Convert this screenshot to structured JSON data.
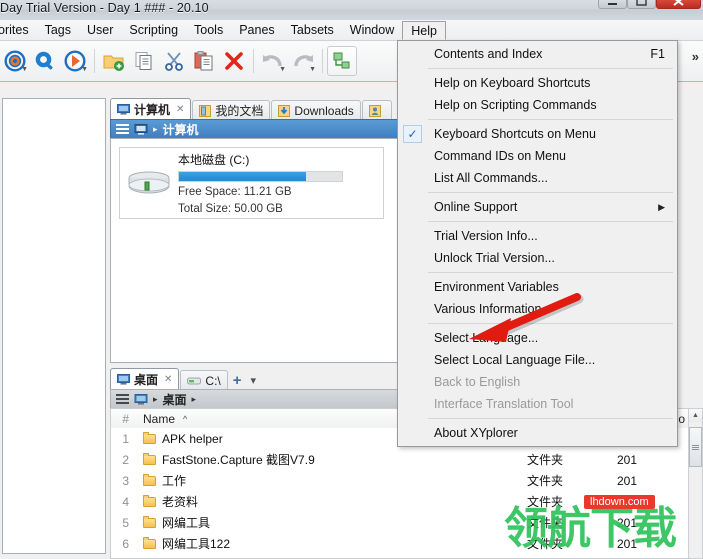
{
  "window": {
    "title": "Day Trial Version - Day 1 ### - 20.10",
    "controls": [
      {
        "name": "minimize",
        "glyph": "—"
      },
      {
        "name": "maximize",
        "glyph": "❐"
      },
      {
        "name": "close",
        "glyph": "✕"
      }
    ]
  },
  "menubar": {
    "items": [
      {
        "label": "orites",
        "open": false
      },
      {
        "label": "Tags",
        "open": false
      },
      {
        "label": "User",
        "open": false
      },
      {
        "label": "Scripting",
        "open": false
      },
      {
        "label": "Tools",
        "open": false
      },
      {
        "label": "Panes",
        "open": false
      },
      {
        "label": "Tabsets",
        "open": false
      },
      {
        "label": "Window",
        "open": false
      },
      {
        "label": "Help",
        "open": true
      }
    ]
  },
  "toolbar": {
    "overflow_label": "»",
    "buttons": [
      {
        "name": "target-icon",
        "has_caret": true
      },
      {
        "name": "search-icon",
        "has_caret": false
      },
      {
        "name": "go-icon",
        "has_caret": true
      },
      {
        "name": "new-folder-icon",
        "has_caret": false
      },
      {
        "name": "copy-icon",
        "has_caret": false
      },
      {
        "name": "cut-icon",
        "has_caret": false
      },
      {
        "name": "paste-icon",
        "has_caret": false
      },
      {
        "name": "delete-icon",
        "has_caret": false
      },
      {
        "name": "undo-icon",
        "has_caret": true
      },
      {
        "name": "redo-icon",
        "has_caret": true
      },
      {
        "name": "tree-icon",
        "has_caret": false
      }
    ]
  },
  "help_menu": {
    "items": [
      {
        "label": "Contents and Index",
        "accel": "F1",
        "type": "item"
      },
      {
        "type": "separator"
      },
      {
        "label": "Help on Keyboard Shortcuts",
        "type": "item"
      },
      {
        "label": "Help on Scripting Commands",
        "type": "item"
      },
      {
        "type": "separator"
      },
      {
        "label": "Keyboard Shortcuts on Menu",
        "type": "item",
        "checked": true
      },
      {
        "label": "Command IDs on Menu",
        "type": "item"
      },
      {
        "label": "List All Commands...",
        "type": "item"
      },
      {
        "type": "separator"
      },
      {
        "label": "Online Support",
        "type": "submenu",
        "submenu_glyph": "▶"
      },
      {
        "type": "separator"
      },
      {
        "label": "Trial Version Info...",
        "type": "item"
      },
      {
        "label": "Unlock Trial Version...",
        "type": "item"
      },
      {
        "type": "separator"
      },
      {
        "label": "Environment Variables",
        "type": "item"
      },
      {
        "label": "Various Information",
        "type": "item"
      },
      {
        "type": "separator"
      },
      {
        "label": "Select Language...",
        "type": "item"
      },
      {
        "label": "Select Local Language File...",
        "type": "item"
      },
      {
        "label": "Back to English",
        "type": "item",
        "disabled": true
      },
      {
        "label": "Interface Translation Tool",
        "type": "item",
        "disabled": true
      },
      {
        "type": "separator"
      },
      {
        "label": "About XYplorer",
        "type": "item"
      }
    ]
  },
  "top_pane": {
    "tabs": [
      {
        "label": "计算机",
        "active": true,
        "closable": true,
        "icon": "computer-icon"
      },
      {
        "label": "我的文档",
        "active": false,
        "closable": false,
        "icon": "documents-icon"
      },
      {
        "label": "Downloads",
        "active": false,
        "closable": false,
        "icon": "downloads-icon"
      },
      {
        "label": "",
        "active": false,
        "closable": false,
        "icon": "contacts-icon"
      }
    ],
    "breadcrumb": {
      "icon": "computer-icon",
      "path": "计算机",
      "separator": "▸"
    },
    "drive": {
      "name": "本地磁盘 (C:)",
      "free_space": "Free Space: 11.21 GB",
      "total_size": "Total Size: 50.00 GB",
      "used_percent": 78
    }
  },
  "bottom_pane": {
    "tabs": [
      {
        "label": "桌面",
        "active": true,
        "closable": true,
        "icon": "desktop-icon"
      },
      {
        "label": "C:\\",
        "active": false,
        "closable": false,
        "icon": "drive-icon"
      }
    ],
    "add_tab_label": "+",
    "tab_menu_label": "▾",
    "breadcrumb": {
      "icon": "desktop-icon",
      "path": "桌面",
      "separator": "▸"
    },
    "columns": [
      "#",
      "Name",
      "",
      "Mo"
    ],
    "sort_indicator": "^",
    "rows": [
      {
        "num": "1",
        "name": "APK helper",
        "type": "",
        "modified": ""
      },
      {
        "num": "2",
        "name": "FastStone.Capture 截图V7.9",
        "type": "文件夹",
        "modified": "201"
      },
      {
        "num": "3",
        "name": "工作",
        "type": "文件夹",
        "modified": "201"
      },
      {
        "num": "4",
        "name": "老资料",
        "type": "文件夹",
        "modified": "201"
      },
      {
        "num": "5",
        "name": "网编工具",
        "type": "文件夹",
        "modified": "201"
      },
      {
        "num": "6",
        "name": "网编工具122",
        "type": "文件夹",
        "modified": "201"
      }
    ]
  },
  "watermark": {
    "text": "领航下载",
    "badge": "lhdown.com",
    "color": "#2fc25b"
  },
  "annotation": {
    "type": "arrow",
    "color": "#e01b10",
    "points_to": "Select Language..."
  }
}
